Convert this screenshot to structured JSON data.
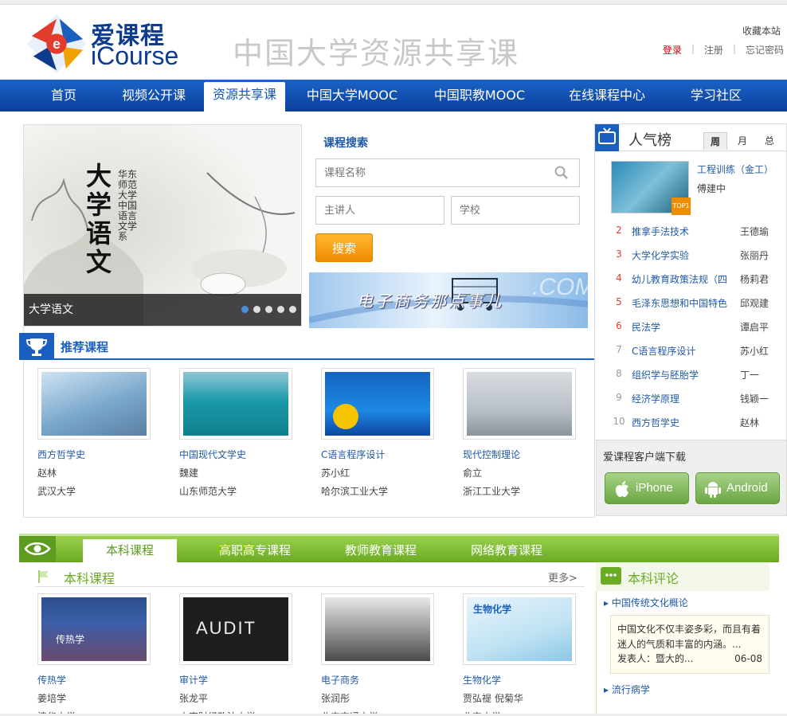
{
  "header": {
    "brand_cn": "爱课程",
    "brand_en": "iCourse",
    "site_title": "中国大学资源共享课",
    "favorite": "收藏本站",
    "login": "登录",
    "register": "注册",
    "forgot": "忘记密码"
  },
  "nav": {
    "items": [
      {
        "label": "首页"
      },
      {
        "label": "视频公开课"
      },
      {
        "label": "资源共享课"
      },
      {
        "label": "中国大学MOOC"
      },
      {
        "label": "中国职教MOOC"
      },
      {
        "label": "在线课程中心"
      },
      {
        "label": "学习社区"
      }
    ],
    "active_index": 2
  },
  "banner": {
    "caption": "大学语文",
    "title_art": "大学语文",
    "side_art": "华东师范大学 中国语言文学系"
  },
  "search": {
    "title": "课程搜索",
    "course_placeholder": "课程名称",
    "teacher_placeholder": "主讲人",
    "school_placeholder": "学校",
    "button": "搜索"
  },
  "ad": {
    "text": "电子商务那点事儿",
    "word": ".COM"
  },
  "recommended": {
    "title": "推荐课程",
    "courses": [
      {
        "name": "西方哲学史",
        "teacher": "赵林",
        "school": "武汉大学"
      },
      {
        "name": "中国现代文学史",
        "teacher": "魏建",
        "school": "山东师范大学"
      },
      {
        "name": "C语言程序设计",
        "teacher": "苏小红",
        "school": "哈尔滨工业大学"
      },
      {
        "name": "现代控制理论",
        "teacher": "俞立",
        "school": "浙江工业大学"
      }
    ]
  },
  "ranking": {
    "title": "人气榜",
    "tabs": [
      "周",
      "月",
      "总"
    ],
    "top1": {
      "name": "工程训练（金工）",
      "teacher": "傅建中",
      "badge": "TOP1"
    },
    "rows": [
      {
        "num": "2",
        "course": "推拿手法技术",
        "teacher": "王德瑜"
      },
      {
        "num": "3",
        "course": "大学化学实验",
        "teacher": "张丽丹"
      },
      {
        "num": "4",
        "course": "幼儿教育政策法规（四",
        "teacher": "杨莉君"
      },
      {
        "num": "5",
        "course": "毛泽东思想和中国特色",
        "teacher": "邱观建"
      },
      {
        "num": "6",
        "course": "民法学",
        "teacher": "谭启平"
      },
      {
        "num": "7",
        "course": "C语言程序设计",
        "teacher": "苏小红"
      },
      {
        "num": "8",
        "course": "组织学与胚胎学",
        "teacher": "丁一"
      },
      {
        "num": "9",
        "course": "经济学原理",
        "teacher": "钱颖一"
      },
      {
        "num": "10",
        "course": "西方哲学史",
        "teacher": "赵林"
      }
    ]
  },
  "client": {
    "title": "爱课程客户端下载",
    "iphone": "iPhone",
    "android": "Android"
  },
  "tabs2": {
    "items": [
      "本科课程",
      "高职高专课程",
      "教师教育课程",
      "网络教育课程"
    ],
    "subtitle": "本科课程",
    "more": "更多>"
  },
  "undergrad": {
    "courses": [
      {
        "name": "传热学",
        "teacher": "姜培学",
        "school": "清华大学",
        "cover": "传热学"
      },
      {
        "name": "审计学",
        "teacher": "张龙平",
        "school": "中南财经政法大学",
        "cover": "AUDIT"
      },
      {
        "name": "电子商务",
        "teacher": "张润彤",
        "school": "北京交通大学",
        "cover": ""
      },
      {
        "name": "生物化学",
        "teacher": "贾弘禔 倪菊华",
        "school": "北京大学",
        "cover": "生物化学"
      }
    ]
  },
  "comments": {
    "title": "本科评论",
    "items": [
      {
        "course": "中国传统文化概论",
        "text": "中国文化不仅丰姿多彩，而且有着迷人的气质和丰富的内涵。...",
        "author": "发表人：暨大的...",
        "date": "06-08"
      },
      {
        "course": "流行病学"
      }
    ]
  },
  "colors": {
    "nav_blue": "#0c3f9c",
    "green": "#6bab24",
    "orange": "#f08c00",
    "link": "#1f5aa6"
  }
}
